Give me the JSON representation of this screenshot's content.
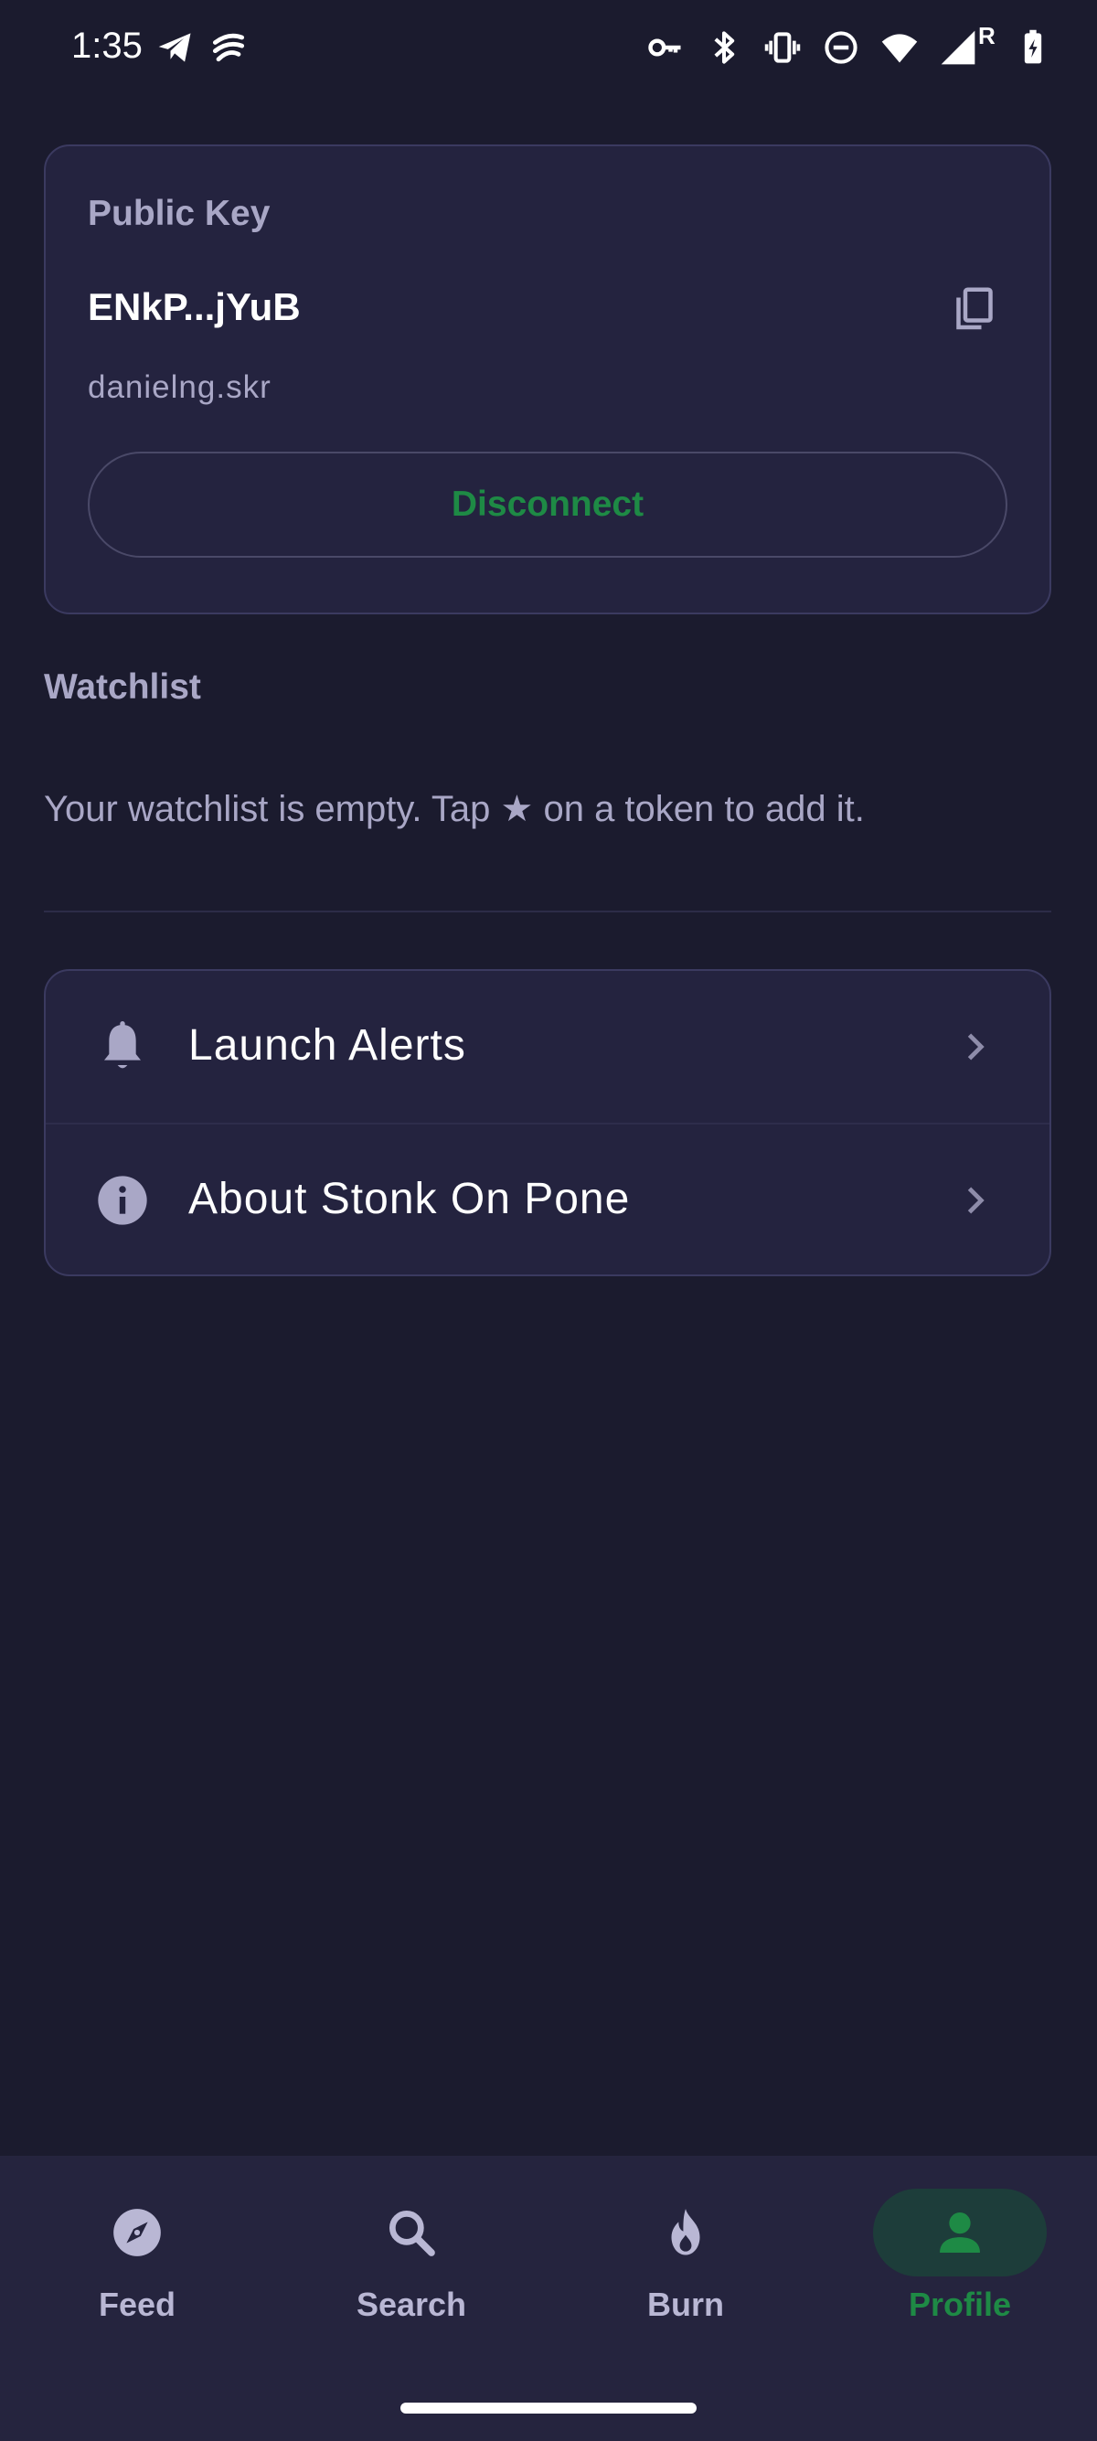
{
  "status_bar": {
    "time": "1:35",
    "icons": [
      "telegram-icon",
      "app-notification-icon",
      "vpn-key-icon",
      "bluetooth-icon",
      "vibrate-icon",
      "do-not-disturb-icon",
      "wifi-icon",
      "signal-roaming-icon",
      "battery-charging-icon"
    ],
    "roaming_letter": "R"
  },
  "wallet_card": {
    "label": "Public Key",
    "public_key": "ENkP...jYuB",
    "domain": "danielng.skr",
    "disconnect_label": "Disconnect"
  },
  "watchlist": {
    "title": "Watchlist",
    "empty_message": "Your watchlist is empty. Tap ★ on a token to add it."
  },
  "menu": {
    "items": [
      {
        "label": "Launch Alerts",
        "icon": "bell-icon"
      },
      {
        "label": "About Stonk On Pone",
        "icon": "info-icon"
      }
    ]
  },
  "bottom_nav": {
    "items": [
      {
        "label": "Feed",
        "icon": "compass-icon",
        "active": false
      },
      {
        "label": "Search",
        "icon": "search-icon",
        "active": false
      },
      {
        "label": "Burn",
        "icon": "flame-icon",
        "active": false
      },
      {
        "label": "Profile",
        "icon": "person-icon",
        "active": true
      }
    ]
  },
  "colors": {
    "background": "#1b1b2e",
    "card": "#24233f",
    "accent_green": "#1e8a45",
    "muted_text": "#a9a7c6",
    "nav_background": "#25243e"
  }
}
